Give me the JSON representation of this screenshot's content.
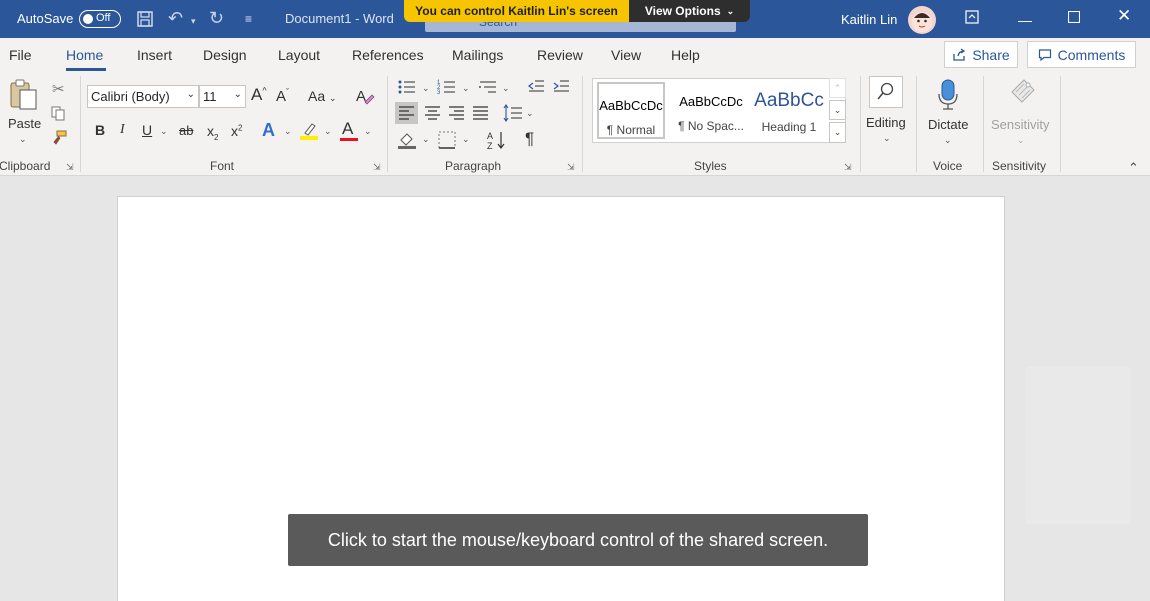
{
  "titlebar": {
    "autosave_label": "AutoSave",
    "autosave_state": "Off",
    "document_title": "Document1  -  Word",
    "search_placeholder": "Search",
    "user_name": "Kaitlin Lin"
  },
  "share_banner": {
    "control_text": "You can control Kaitlin Lin's screen",
    "view_options_label": "View Options"
  },
  "tabs": [
    "File",
    "Home",
    "Insert",
    "Design",
    "Layout",
    "References",
    "Mailings",
    "Review",
    "View",
    "Help"
  ],
  "active_tab": "Home",
  "header_buttons": {
    "share": "Share",
    "comments": "Comments"
  },
  "ribbon": {
    "clipboard": {
      "paste_label": "Paste",
      "group_label": "Clipboard"
    },
    "font": {
      "font_name": "Calibri (Body)",
      "font_size": "11",
      "grow_font": "A",
      "shrink_font": "A",
      "change_case": "Aa",
      "bold": "B",
      "italic": "I",
      "underline": "U",
      "strikethrough": "ab",
      "subscript": "x",
      "subscript_mark": "2",
      "superscript": "x",
      "superscript_mark": "2",
      "text_effects": "A",
      "font_color": "A",
      "group_label": "Font"
    },
    "paragraph": {
      "group_label": "Paragraph",
      "show_marks": "¶"
    },
    "styles": {
      "group_label": "Styles",
      "items": [
        {
          "preview": "AaBbCcDc",
          "name": "¶ Normal"
        },
        {
          "preview": "AaBbCcDc",
          "name": "¶ No Spac..."
        },
        {
          "preview": "AaBbCc",
          "name": "Heading 1"
        }
      ]
    },
    "editing": {
      "label": "Editing"
    },
    "voice": {
      "dictate_label": "Dictate",
      "group_label": "Voice"
    },
    "sensitivity": {
      "button_label": "Sensitivity",
      "group_label": "Sensitivity"
    }
  },
  "overlay_message": "Click to start the mouse/keyboard control of the shared screen.",
  "colors": {
    "titlebar": "#2b579a",
    "banner_yellow": "#f6c500",
    "highlight": "#ffee00",
    "font_color": "#e81123"
  }
}
